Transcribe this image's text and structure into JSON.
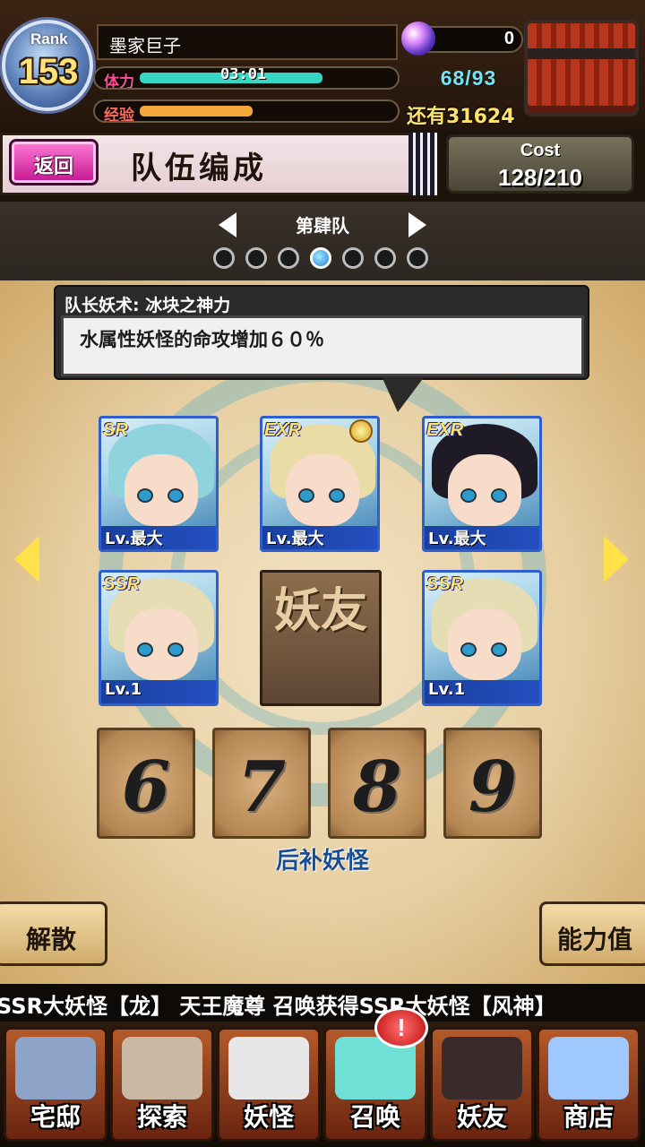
{
  "header": {
    "rank_label": "Rank",
    "rank_value": "153",
    "player_name": "墨家巨子",
    "stamina_label": "体力",
    "stamina_timer": "03:01",
    "stamina_count": "68/93",
    "stamina_fraction": 0.73,
    "exp_label": "经验",
    "exp_fraction": 0.45,
    "remaining_exp": "还有31624",
    "gem_count": "0"
  },
  "title_bar": {
    "back_label": "返回",
    "title": "队伍编成",
    "cost_label": "Cost",
    "cost_value": "128/210"
  },
  "team_selector": {
    "team_name": "第肆队",
    "dot_count": 7,
    "active_index": 3
  },
  "leader_skill": {
    "title": "队长妖术: 冰块之神力",
    "description": "水属性妖怪的命攻增加６０％"
  },
  "team": {
    "members": [
      {
        "rarity": "SR",
        "level": "Lv.最大",
        "hair": "#8fd3dc"
      },
      {
        "rarity": "EXR",
        "level": "Lv.最大",
        "hair": "#e9dca7",
        "leader": true
      },
      {
        "rarity": "EXR",
        "level": "Lv.最大",
        "hair": "#1e1a26"
      },
      {
        "rarity": "SSR",
        "level": "Lv.1",
        "hair": "#e6ddb5"
      },
      {
        "rarity": "SSR",
        "level": "Lv.1",
        "hair": "#e6ddb5"
      }
    ],
    "friend_slot_text": "妖友",
    "reserve_slots": [
      "6",
      "7",
      "8",
      "9"
    ],
    "reserve_label": "后补妖怪"
  },
  "actions": {
    "disband": "解散",
    "stats": "能力值"
  },
  "ticker_text": "SSR大妖怪【龙】  天王魔尊 召唤获得SSR大妖怪【风神】",
  "bottom_nav": {
    "tabs": [
      "宅邸",
      "探索",
      "妖怪",
      "召唤",
      "妖友",
      "商店"
    ],
    "summon_badge": "!"
  },
  "colors": {
    "accent_cyan": "#6fe5f7",
    "gold": "#ffe36a",
    "stamina_fill": "#36d6c4",
    "exp_fill": "#f2a83a",
    "back_button": "#e33bb0"
  }
}
